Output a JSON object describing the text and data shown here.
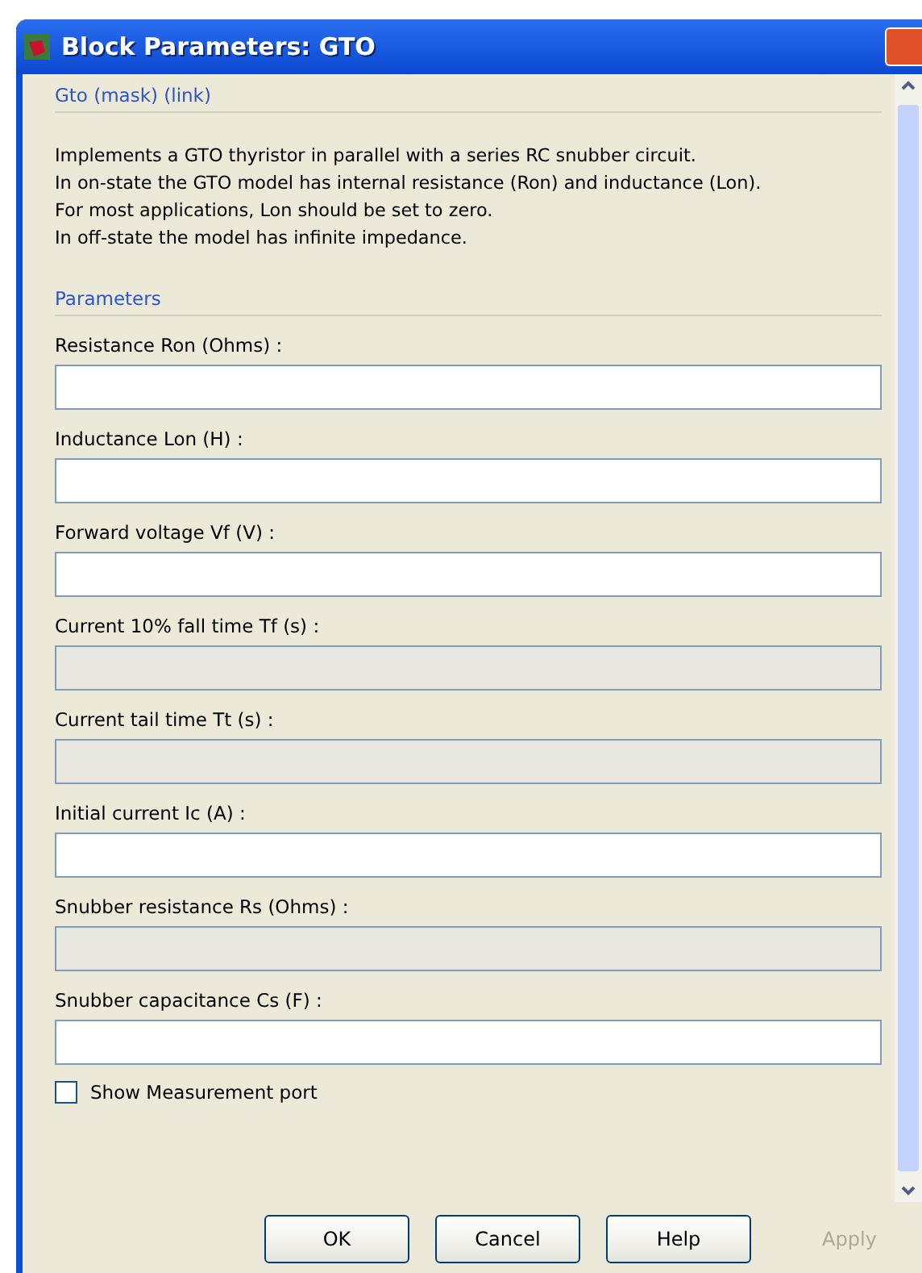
{
  "window": {
    "title": "Block Parameters: GTO"
  },
  "mask_title": "Gto (mask) (link)",
  "description": [
    "Implements a GTO thyristor in parallel with a series RC snubber circuit.",
    "In on-state the GTO model has internal resistance (Ron) and inductance (Lon).",
    "For most applications, Lon should be set to zero.",
    "In off-state the model has infinite impedance."
  ],
  "parameters_title": "Parameters",
  "fields": [
    {
      "label": "Resistance Ron (Ohms) :",
      "disabled": false
    },
    {
      "label": "Inductance Lon (H) :",
      "disabled": false
    },
    {
      "label": "Forward voltage Vf (V) :",
      "disabled": false
    },
    {
      "label": "Current 10% fall time Tf (s) :",
      "disabled": true
    },
    {
      "label": "Current tail time Tt (s) :",
      "disabled": true
    },
    {
      "label": "Initial current Ic (A) :",
      "disabled": false
    },
    {
      "label": "Snubber resistance Rs (Ohms) :",
      "disabled": true
    },
    {
      "label": "Snubber capacitance Cs (F) :",
      "disabled": false
    }
  ],
  "checkbox": {
    "label": "Show Measurement port",
    "checked": false
  },
  "buttons": [
    {
      "label": "OK",
      "disabled": false
    },
    {
      "label": "Cancel",
      "disabled": false
    },
    {
      "label": "Help",
      "disabled": false
    },
    {
      "label": "Apply",
      "disabled": true
    }
  ]
}
